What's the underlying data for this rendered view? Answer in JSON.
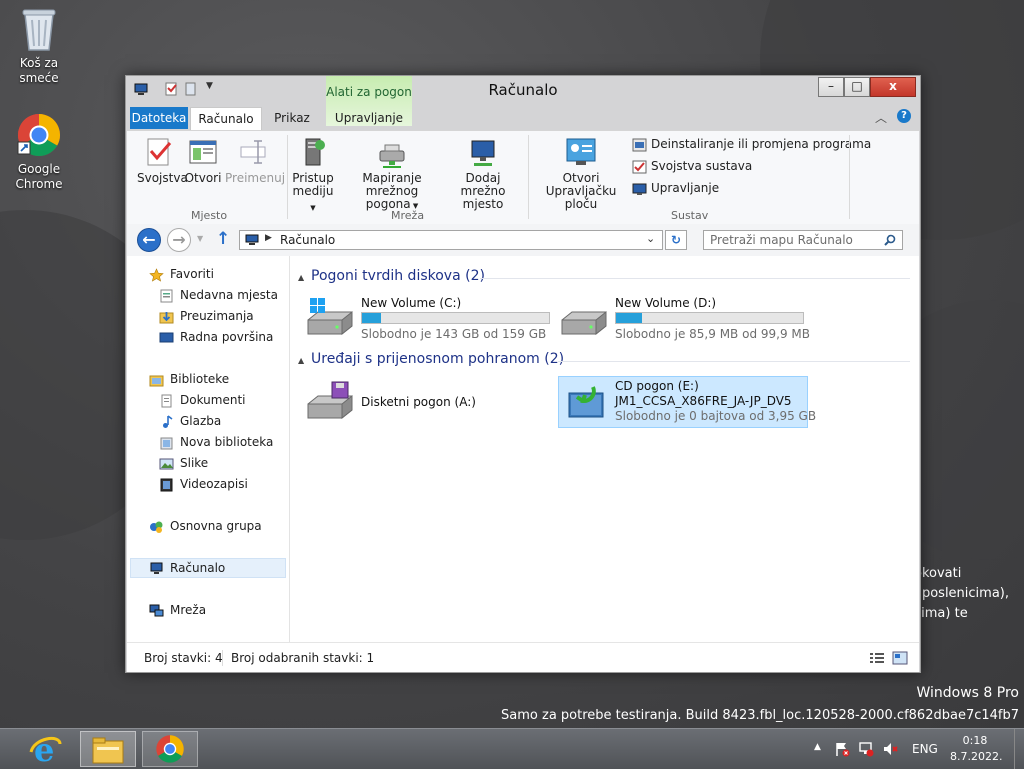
{
  "desktop": {
    "recycle_bin": "Koš za smeće",
    "chrome": "Google Chrome",
    "watermark_edition": "Windows 8 Pro",
    "watermark_build": "Samo za potrebe testiranja. Build 8423.fbl_loc.120528-2000.cf862dbae7c14fb7",
    "partial_text_1": "okovati",
    "partial_text_2": "aposlenicima),",
    "partial_text_3": "cima) te"
  },
  "window": {
    "title": "Računalo",
    "contextual_tab_group": "Alati za pogon",
    "controls": {
      "minimize": "–",
      "maximize": "□",
      "close": "x"
    }
  },
  "tabs": [
    "Datoteka",
    "Računalo",
    "Prikaz",
    "Upravljanje"
  ],
  "ribbon": {
    "location": {
      "group": "Mjesto",
      "properties": "Svojstva",
      "open": "Otvori",
      "rename": "Preimenuj"
    },
    "network": {
      "group": "Mreža",
      "access_media_1": "Pristup",
      "access_media_2": "mediju",
      "map_drive_1": "Mapiranje mrežnog",
      "map_drive_2": "pogona",
      "add_location_1": "Dodaj mrežno",
      "add_location_2": "mjesto"
    },
    "system": {
      "group": "Sustav",
      "control_panel_1": "Otvori",
      "control_panel_2": "Upravljačku ploču",
      "uninstall": "Deinstaliranje ili promjena programa",
      "sys_props": "Svojstva sustava",
      "manage": "Upravljanje"
    }
  },
  "address": {
    "path": "Računalo",
    "search_placeholder": "Pretraži mapu Računalo"
  },
  "nav": {
    "favorites": "Favoriti",
    "recent": "Nedavna mjesta",
    "downloads": "Preuzimanja",
    "desktop": "Radna površina",
    "libraries": "Biblioteke",
    "documents": "Dokumenti",
    "music": "Glazba",
    "new_library": "Nova biblioteka",
    "pictures": "Slike",
    "videos": "Videozapisi",
    "homegroup": "Osnovna grupa",
    "computer": "Računalo",
    "network": "Mreža"
  },
  "content": {
    "hdd_section": "Pogoni tvrdih diskova (2)",
    "removable_section": "Uređaji s prijenosnom pohranom (2)",
    "drives": [
      {
        "name": "New Volume (C:)",
        "free": "Slobodno je 143 GB od 159 GB",
        "used_fraction": 0.1
      },
      {
        "name": "New Volume (D:)",
        "free": "Slobodno je 85,9 MB od 99,9 MB",
        "used_fraction": 0.14
      }
    ],
    "floppy": {
      "name": "Disketni pogon (A:)"
    },
    "cd": {
      "name": "CD pogon (E:)",
      "label": "JM1_CCSA_X86FRE_JA-JP_DV5",
      "free": "Slobodno je 0 bajtova od 3,95 GB"
    }
  },
  "status": {
    "items": "Broj stavki: 4",
    "selected": "Broj odabranih stavki: 1"
  },
  "tray": {
    "language": "ENG",
    "time": "0:18",
    "date": "8.7.2022."
  }
}
